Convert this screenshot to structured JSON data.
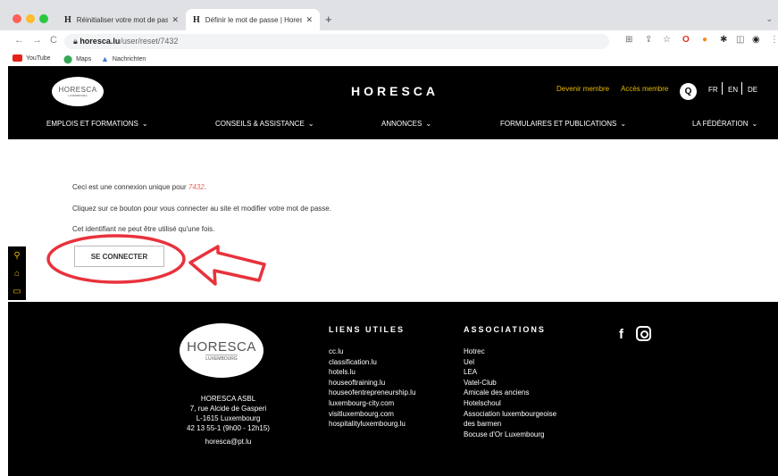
{
  "browser": {
    "tabs": [
      {
        "label": "Réinitialiser votre mot de passe",
        "favicon": "H",
        "active": false
      },
      {
        "label": "Définir le mot de passe | Horesc",
        "favicon": "H",
        "active": true
      }
    ],
    "url_domain": "horesca.lu",
    "url_path": "/user/reset/7432",
    "bookmarks": [
      "YouTube",
      "Maps",
      "Nachrichten"
    ]
  },
  "header": {
    "logo_text": "HORESCA",
    "logo_sub": "LUXEMBOURG",
    "brand": "HORESCA",
    "devenir": "Devenir membre",
    "acces": "Accès membre",
    "langs": [
      "FR",
      "EN",
      "DE"
    ],
    "menu": [
      "EMPLOIS ET FORMATIONS",
      "CONSEILS & ASSISTANCE",
      "ANNONCES",
      "FORMULAIRES ET PUBLICATIONS",
      "LA FÉDÉRATION"
    ]
  },
  "main": {
    "line1_pre": "Ceci est une connexion unique pour",
    "line1_user": "7432",
    "line1_post": ".",
    "line2": "Cliquez sur ce bouton pour vous connecter au site et modifier votre mot de passe.",
    "line3": "Cet identifiant ne peut être utilisé qu'une fois.",
    "button": "SE CONNECTER"
  },
  "footer": {
    "logo_text": "HORESCA",
    "logo_sub": "LUXEMBOURG",
    "address": [
      "HORESCA ASBL",
      "7, rue Alcide de Gasperi",
      "L-1615 Luxembourg",
      "42 13 55-1 (9h00 - 12h15)",
      "horesca@pt.lu"
    ],
    "liens_title": "LIENS UTILES",
    "liens": [
      "cc.lu",
      "classification.lu",
      "hotels.lu",
      "houseoftraining.lu",
      "houseofentrepreneurship.lu",
      "luxembourg-city.com",
      "visitluxembourg.com",
      "hospitalityluxembourg.lu"
    ],
    "assoc_title": "ASSOCIATIONS",
    "assoc": [
      "Hotrec",
      "Uel",
      "LEA",
      "Vatel-Club",
      "Amicale des anciens",
      "Hotelschoul",
      "Association luxembourgeoise",
      "des barmen",
      "Bocuse d'Or Luxembourg"
    ],
    "social": [
      "facebook-icon",
      "instagram-icon"
    ]
  },
  "colors": {
    "accent_yellow": "#e6b800",
    "annotation_red": "#e8323c",
    "link_pink": "#e8665a"
  }
}
